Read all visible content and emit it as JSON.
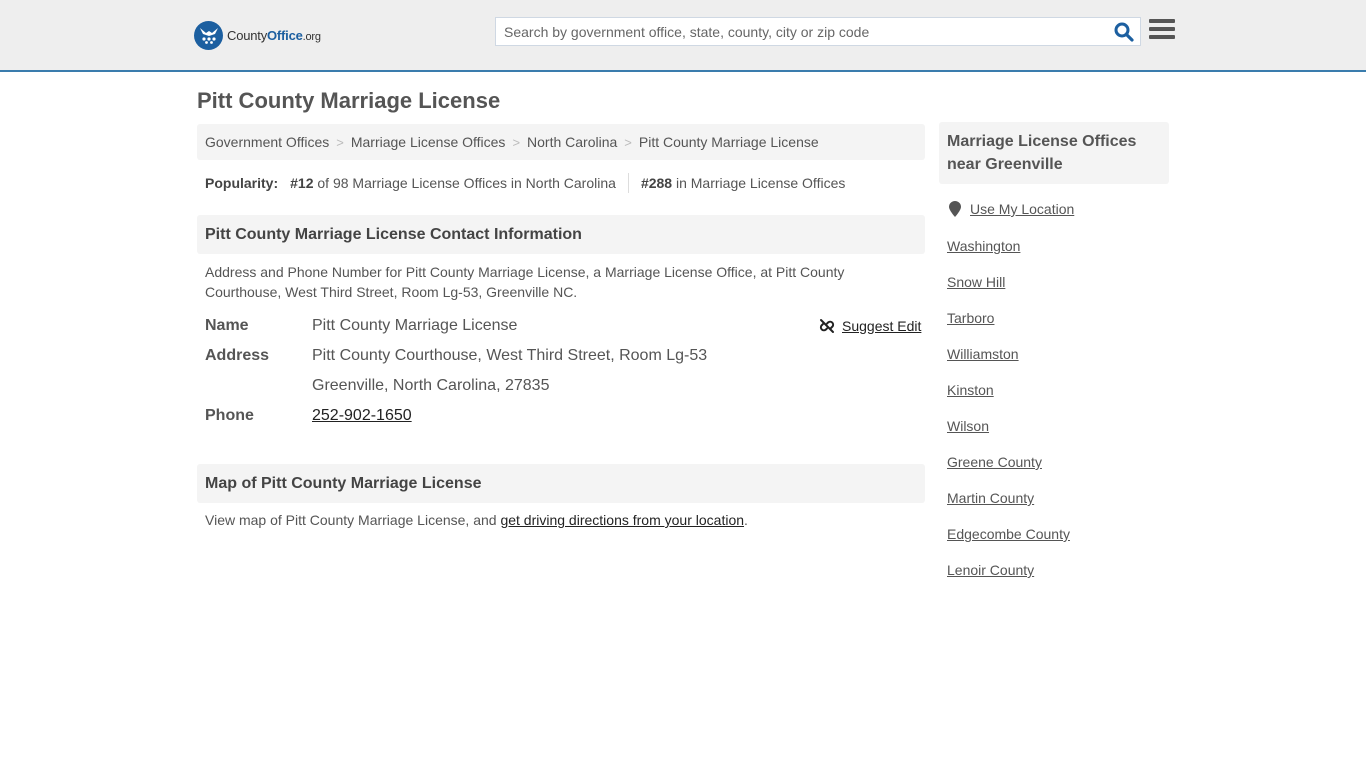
{
  "header": {
    "logo": {
      "part1": "County",
      "part2": "Office",
      "part3": ".org"
    },
    "search": {
      "placeholder": "Search by government office, state, county, city or zip code",
      "value": ""
    },
    "colors": {
      "brand": "#1c5fa0",
      "header_border": "#3a7cad",
      "header_bg": "#eeeeee"
    }
  },
  "page": {
    "title": "Pitt County Marriage License"
  },
  "breadcrumb": [
    {
      "label": "Government Offices"
    },
    {
      "label": "Marriage License Offices"
    },
    {
      "label": "North Carolina"
    },
    {
      "label": "Pitt County Marriage License"
    }
  ],
  "breadcrumb_separator": ">",
  "popularity": {
    "label": "Popularity:",
    "state_rank": "#12",
    "state_text": "of 98 Marriage License Offices in North Carolina",
    "national_rank": "#288",
    "national_text": "in Marriage License Offices"
  },
  "contact": {
    "heading": "Pitt County Marriage License Contact Information",
    "description": "Address and Phone Number for Pitt County Marriage License, a Marriage License Office, at Pitt County Courthouse, West Third Street, Room Lg-53, Greenville NC.",
    "suggest_edit": "Suggest Edit",
    "name_label": "Name",
    "name_value": "Pitt County Marriage License",
    "address_label": "Address",
    "address_line1": "Pitt County Courthouse, West Third Street, Room Lg-53",
    "address_line2": "Greenville, North Carolina, 27835",
    "phone_label": "Phone",
    "phone_value": "252-902-1650"
  },
  "map": {
    "heading": "Map of Pitt County Marriage License",
    "text_before": "View map of Pitt County Marriage License, and ",
    "link": "get driving directions from your location",
    "text_after": "."
  },
  "sidebar": {
    "heading": "Marriage License Offices near Greenville",
    "use_location": "Use My Location",
    "items": [
      {
        "label": "Washington"
      },
      {
        "label": "Snow Hill"
      },
      {
        "label": "Tarboro"
      },
      {
        "label": "Williamston"
      },
      {
        "label": "Kinston"
      },
      {
        "label": "Wilson"
      },
      {
        "label": "Greene County"
      },
      {
        "label": "Martin County"
      },
      {
        "label": "Edgecombe County"
      },
      {
        "label": "Lenoir County"
      }
    ]
  }
}
